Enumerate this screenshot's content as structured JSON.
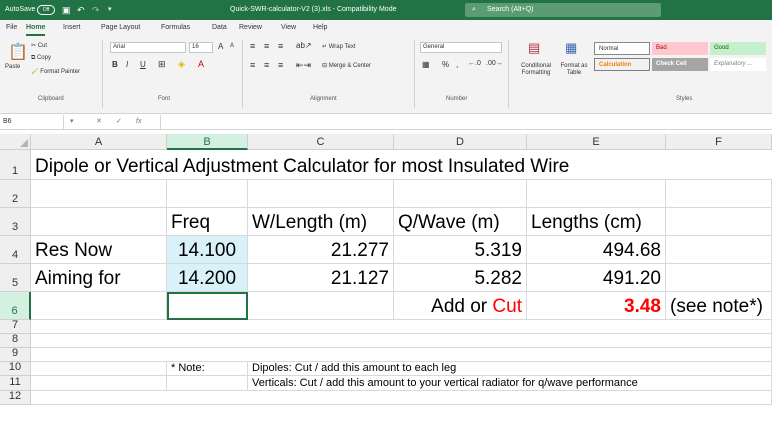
{
  "titlebar": {
    "autosave": "AutoSave",
    "autosave_state": "Off",
    "title": "Quick-SWR-calculator-V2 (3).xls  -  Compatibility Mode",
    "search_placeholder": "Search (Alt+Q)"
  },
  "tabs": [
    "File",
    "Home",
    "Insert",
    "Page Layout",
    "Formulas",
    "Data",
    "Review",
    "View",
    "Help"
  ],
  "ribbon": {
    "clipboard": {
      "paste": "Paste",
      "cut": "Cut",
      "copy": "Copy",
      "format_painter": "Format Painter",
      "label": "Clipboard"
    },
    "font": {
      "name": "Arial",
      "size": "16",
      "bold": "B",
      "italic": "I",
      "underline": "U",
      "grow": "A",
      "shrink": "A",
      "label": "Font"
    },
    "alignment": {
      "wrap_text": "Wrap Text",
      "merge_center": "Merge & Center",
      "label": "Alignment"
    },
    "number": {
      "format": "General",
      "label": "Number"
    },
    "styles": {
      "conditional_formatting": "Conditional Formatting",
      "format_as_table": "Format as Table",
      "normal": "Normal",
      "bad": "Bad",
      "good": "Good",
      "calculation": "Calculation",
      "check_cell": "Check Cell",
      "explanatory": "Explanatory ...",
      "label": "Styles"
    }
  },
  "formula_bar": {
    "name_box": "B6",
    "fx": "fx",
    "formula": ""
  },
  "columns": [
    "A",
    "B",
    "C",
    "D",
    "E",
    "F"
  ],
  "rows": [
    "1",
    "2",
    "3",
    "4",
    "5",
    "6",
    "7",
    "8",
    "9",
    "10",
    "11",
    "12"
  ],
  "sheet": {
    "title": "Dipole or Vertical Adjustment Calculator for most Insulated Wire",
    "headers": {
      "freq": "Freq",
      "wlength": "W/Length (m)",
      "qwave": "Q/Wave (m)",
      "lengths": "Lengths (cm)"
    },
    "row4": {
      "label": "Res Now",
      "freq": "14.100",
      "wlength": "21.277",
      "qwave": "5.319",
      "lengths": "494.68"
    },
    "row5": {
      "label": "Aiming for",
      "freq": "14.200",
      "wlength": "21.127",
      "qwave": "5.282",
      "lengths": "491.20"
    },
    "row6": {
      "add_or": "Add or ",
      "cut": "Cut",
      "amount": "3.48",
      "note_ref": "(see note*)"
    },
    "note_label": "* Note:",
    "note_dipoles": "Dipoles: Cut / add this amount to each leg",
    "note_verticals": "Verticals: Cut / add this amount to your vertical radiator for q/wave performance"
  },
  "colors": {
    "excel_green": "#217346",
    "freq_fill": "#d9f2f9",
    "cut_red": "#ff0000"
  }
}
